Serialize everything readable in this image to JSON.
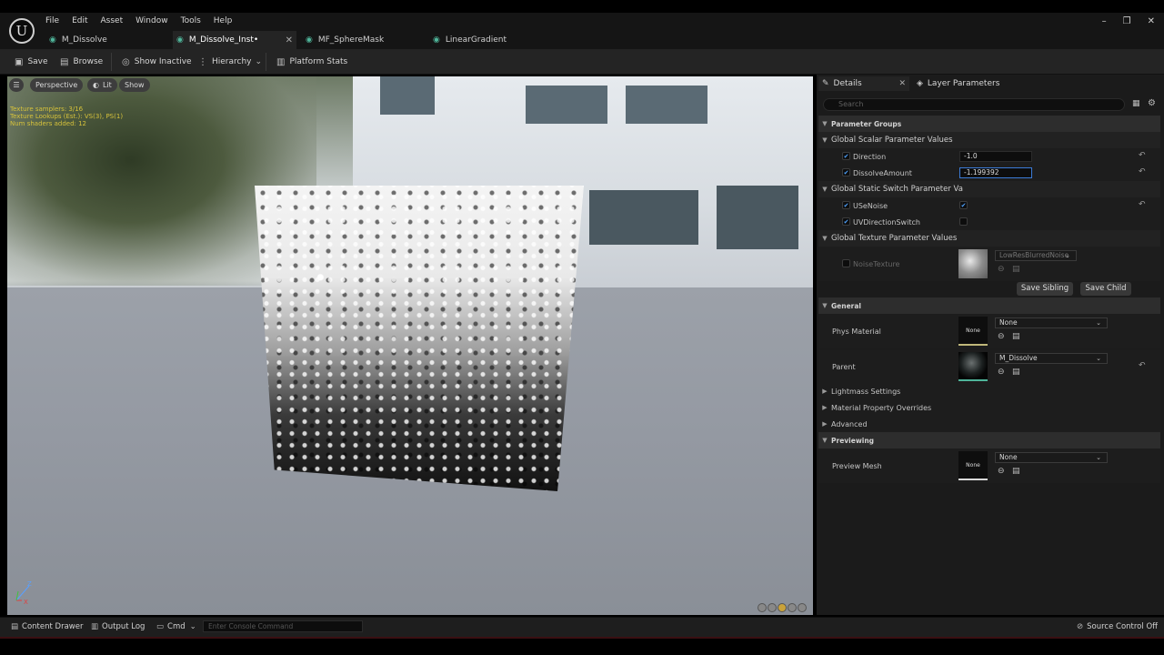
{
  "menu": [
    "File",
    "Edit",
    "Asset",
    "Window",
    "Tools",
    "Help"
  ],
  "tabs": [
    {
      "label": "M_Dissolve",
      "active": false
    },
    {
      "label": "M_Dissolve_Inst•",
      "active": true
    },
    {
      "label": "MF_SphereMask",
      "active": false
    },
    {
      "label": "LinearGradient",
      "active": false
    }
  ],
  "toolbar": {
    "save": "Save",
    "browse": "Browse",
    "show_inactive": "Show Inactive",
    "hierarchy": "Hierarchy",
    "platform_stats": "Platform Stats"
  },
  "viewport": {
    "perspective": "Perspective",
    "lit": "Lit",
    "show": "Show",
    "stats": [
      "Texture samplers: 3/16",
      "Texture Lookups (Est.): VS(3), PS(1)",
      "Num shaders added: 12"
    ],
    "axis_z": "Z",
    "axis_x": "X"
  },
  "details": {
    "tab_details": "Details",
    "tab_layer": "Layer Parameters",
    "search_placeholder": "Search",
    "parameter_groups": "Parameter Groups",
    "scalar_group": "Global Scalar Parameter Values",
    "direction_label": "Direction",
    "direction_value": "-1.0",
    "dissolve_label": "DissolveAmount",
    "dissolve_value": "-1.199392",
    "switch_group": "Global Static Switch Parameter Va",
    "usenoise_label": "USeNoise",
    "uvdir_label": "UVDirectionSwitch",
    "texture_group": "Global Texture Parameter Values",
    "noisetex_label": "NoiseTexture",
    "noisetex_value": "LowResBlurredNoise",
    "save_sibling": "Save Sibling",
    "save_child": "Save Child",
    "general": "General",
    "phys_label": "Phys Material",
    "phys_thumb": "None",
    "phys_value": "None",
    "parent_label": "Parent",
    "parent_value": "M_Dissolve",
    "lightmass": "Lightmass Settings",
    "overrides": "Material Property Overrides",
    "advanced": "Advanced",
    "previewing": "Previewing",
    "preview_label": "Preview Mesh",
    "preview_thumb": "None",
    "preview_value": "None"
  },
  "statusbar": {
    "content_drawer": "Content Drawer",
    "output_log": "Output Log",
    "cmd": "Cmd",
    "console_placeholder": "Enter Console Command",
    "source_control": "Source Control Off"
  }
}
